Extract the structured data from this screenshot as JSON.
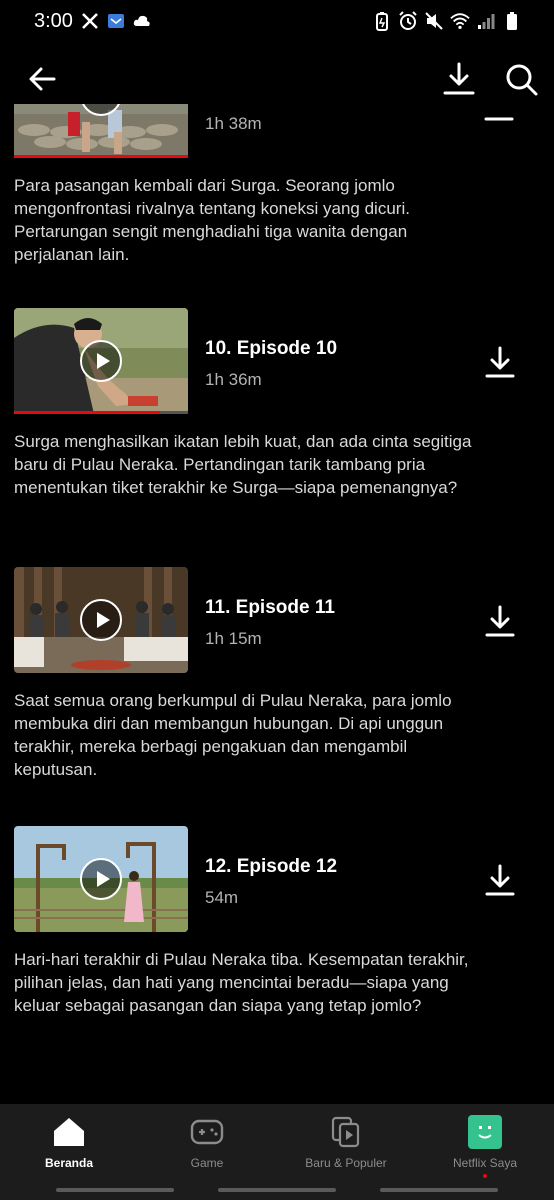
{
  "status": {
    "time": "3:00",
    "icons": [
      "x-logo-icon",
      "mail-app-icon",
      "cloud-icon",
      "battery-saver-icon",
      "alarm-icon",
      "mute-icon",
      "wifi-icon",
      "signal-icon",
      "battery-icon"
    ]
  },
  "topbar": {
    "back_icon": "arrow-left-icon",
    "download_icon": "download-icon",
    "search_icon": "search-icon"
  },
  "episodes": [
    {
      "title": "",
      "duration": "1h 38m",
      "description": "Para pasangan kembali dari Surga. Seorang jomlo mengonfrontasi rivalnya tentang koneksi yang dicuri. Pertarungan sengit menghadiahi tiga wanita dengan perjalanan lain.",
      "progress": 1.0,
      "download_icon": "downloaded-icon"
    },
    {
      "title": "10. Episode 10",
      "duration": "1h 36m",
      "description": "Surga menghasilkan ikatan lebih kuat, dan ada cinta segitiga baru di Pulau Neraka. Pertandingan tarik tambang pria menentukan tiket terakhir ke Surga—siapa pemenangnya?",
      "progress": 0.84,
      "download_icon": "download-icon"
    },
    {
      "title": "11. Episode 11",
      "duration": "1h 15m",
      "description": "Saat semua orang berkumpul di Pulau Neraka, para jomlo membuka diri dan membangun hubungan. Di api unggun terakhir, mereka berbagi pengakuan dan mengambil keputusan.",
      "progress": 0,
      "download_icon": "download-icon"
    },
    {
      "title": "12. Episode 12",
      "duration": "54m",
      "description": "Hari-hari terakhir di Pulau Neraka tiba. Kesempatan terakhir, pilihan jelas, dan hati yang mencintai beradu—siapa yang keluar sebagai pasangan dan siapa yang tetap jomlo?",
      "progress": 0,
      "download_icon": "download-icon"
    }
  ],
  "nav": {
    "items": [
      {
        "label": "Beranda",
        "icon": "home-icon",
        "active": true
      },
      {
        "label": "Game",
        "icon": "gamepad-icon",
        "active": false
      },
      {
        "label": "Baru & Populer",
        "icon": "new-hot-icon",
        "active": false
      },
      {
        "label": "Netflix Saya",
        "icon": "profile-icon",
        "active": false
      }
    ]
  },
  "colors": {
    "background": "#000000",
    "accent": "#e50914",
    "profile": "#34c38f",
    "nav_background": "#1c1c1c"
  }
}
